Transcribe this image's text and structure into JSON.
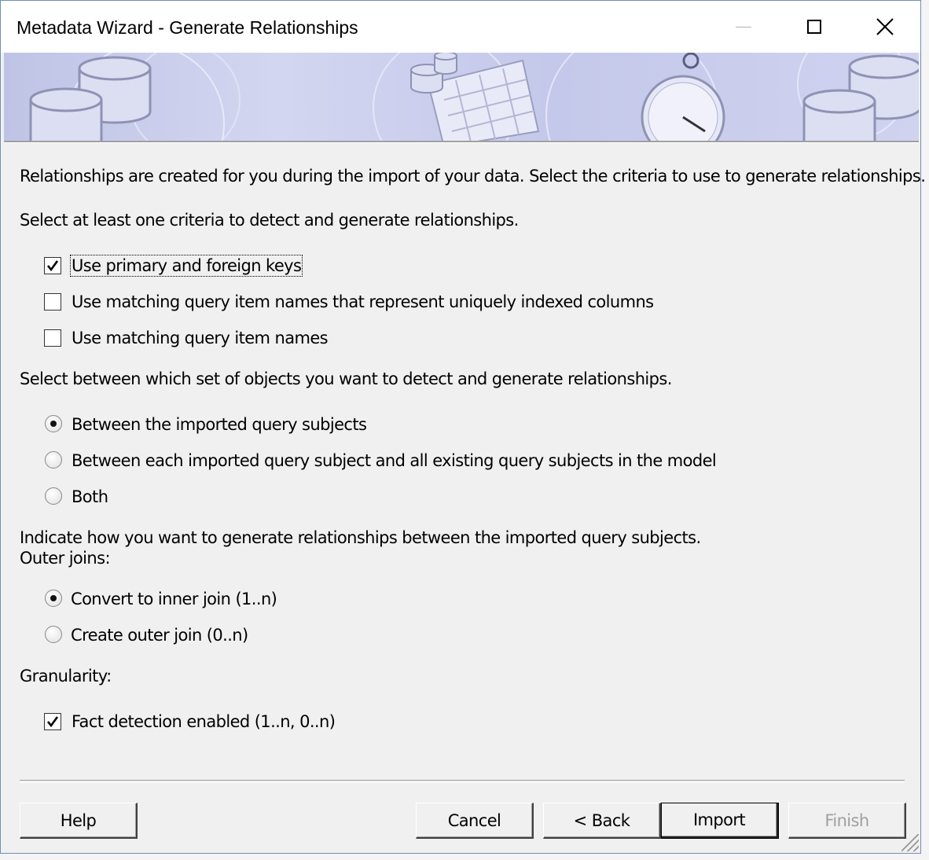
{
  "window": {
    "title": "Metadata Wizard - Generate Relationships",
    "controls": {
      "minimize": "minimize-icon",
      "maximize": "maximize-icon",
      "close": "close-icon"
    }
  },
  "intro": {
    "line1": "Relationships are created for you during the import of your data.  Select the criteria to use to generate relationships.",
    "line2": "Select at least one criteria to detect and generate relationships."
  },
  "criteria": [
    {
      "label": "Use primary and foreign keys",
      "checked": true
    },
    {
      "label": "Use matching query item names that represent uniquely indexed columns",
      "checked": false
    },
    {
      "label": "Use matching query item names",
      "checked": false
    }
  ],
  "objects_heading": "Select between which set of objects you want to detect and generate relationships.",
  "objects": [
    {
      "label": "Between the imported query subjects",
      "selected": true
    },
    {
      "label": "Between each imported query subject and all existing query subjects in the model",
      "selected": false
    },
    {
      "label": "Both",
      "selected": false
    }
  ],
  "joins_heading": "Indicate how you want to generate relationships between the imported query subjects.",
  "outer_joins_label": "Outer joins:",
  "joins": [
    {
      "label": "Convert to inner join (1..n)",
      "selected": true
    },
    {
      "label": "Create outer join (0..n)",
      "selected": false
    }
  ],
  "granularity_label": "Granularity:",
  "granularity": [
    {
      "label": "Fact detection enabled (1..n, 0..n)",
      "checked": true
    }
  ],
  "buttons": {
    "help": "Help",
    "cancel": "Cancel",
    "back": "< Back",
    "import": "Import",
    "finish": "Finish"
  },
  "colors": {
    "banner": "#c4c8ea",
    "dialog_bg": "#f0f0f0",
    "disabled_text": "#a0a0a0"
  }
}
